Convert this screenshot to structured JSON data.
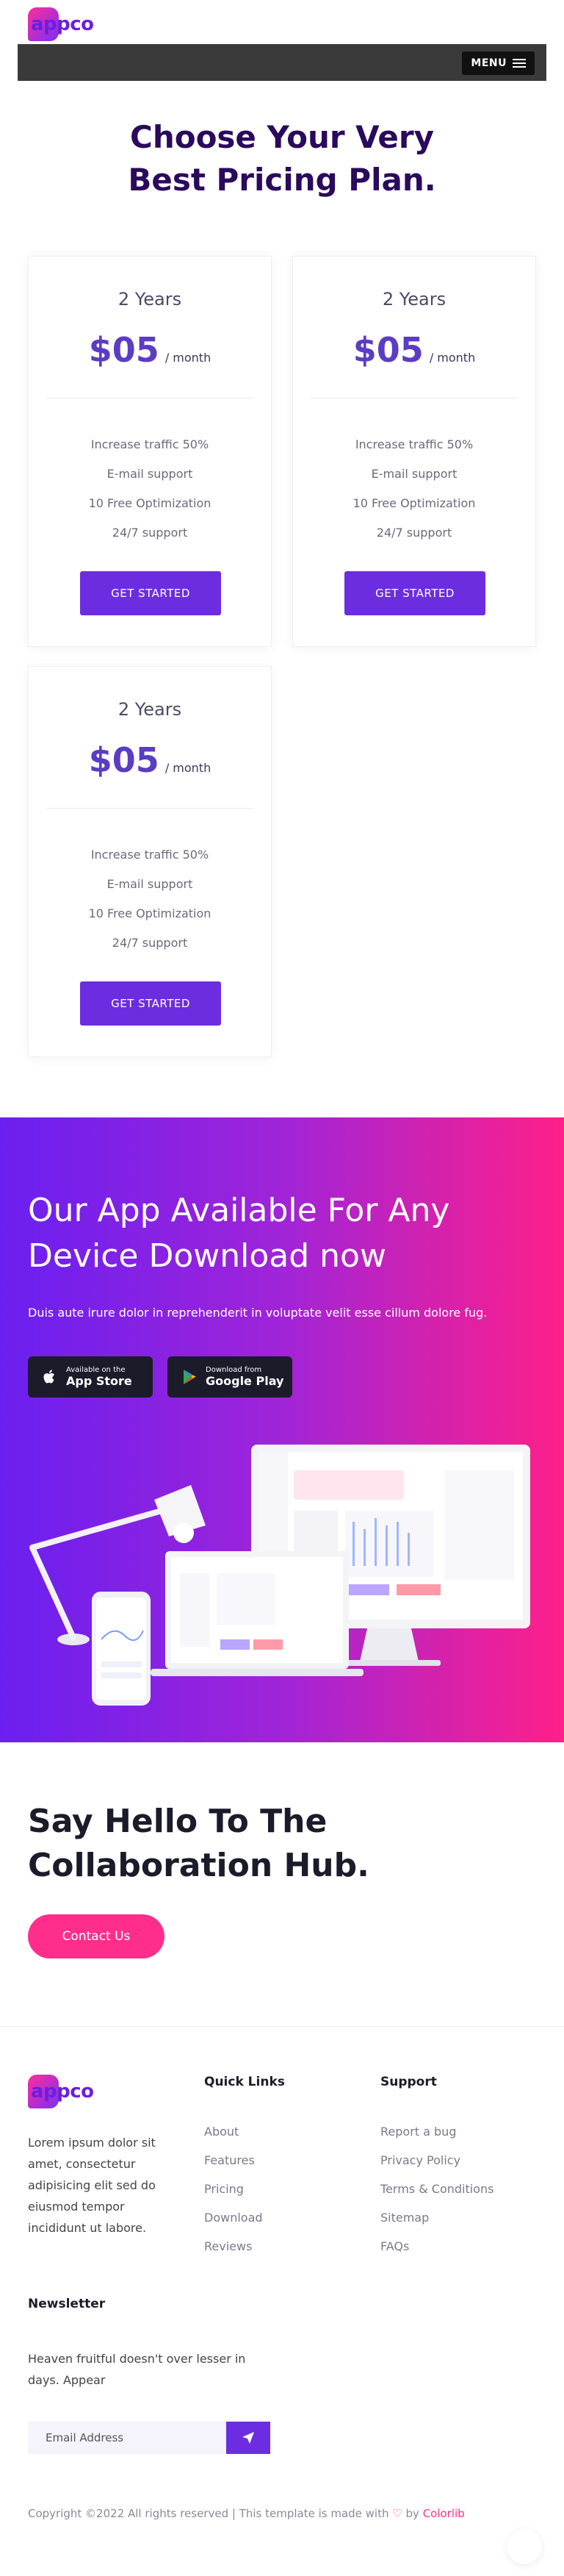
{
  "brand": {
    "logo": "appco"
  },
  "header": {
    "menu_label": "MENU"
  },
  "pricing": {
    "title_line1": "Choose Your Very",
    "title_line2": "Best Pricing Plan.",
    "plans": [
      {
        "duration": "2 Years",
        "price": "$05",
        "period": "/ month",
        "features": [
          "Increase traffic 50%",
          "E-mail support",
          "10 Free Optimization",
          "24/7 support"
        ],
        "button": "GET STARTED"
      },
      {
        "duration": "2 Years",
        "price": "$05",
        "period": "/ month",
        "features": [
          "Increase traffic 50%",
          "E-mail support",
          "10 Free Optimization",
          "24/7 support"
        ],
        "button": "GET STARTED"
      },
      {
        "duration": "2 Years",
        "price": "$05",
        "period": "/ month",
        "features": [
          "Increase traffic 50%",
          "E-mail support",
          "10 Free Optimization",
          "24/7 support"
        ],
        "button": "GET STARTED"
      }
    ]
  },
  "app_section": {
    "title_line1": "Our App Available For Any",
    "title_line2": "Device Download now",
    "description": "Duis aute irure dolor in reprehenderit in voluptate velit esse cillum dolore fug.",
    "appstore": {
      "small": "Available on the",
      "big": "App Store"
    },
    "googleplay": {
      "small": "Download from",
      "big": "Google Play"
    }
  },
  "collab": {
    "title_line1": "Say Hello To The",
    "title_line2": "Collaboration Hub.",
    "button": "Contact Us"
  },
  "footer": {
    "description": "Lorem ipsum dolor sit amet, consectetur adipisicing elit sed do eiusmod tempor incididunt ut labore.",
    "quick_links": {
      "title": "Quick Links",
      "items": [
        "About",
        "Features",
        "Pricing",
        "Download",
        "Reviews"
      ]
    },
    "support": {
      "title": "Support",
      "items": [
        "Report a bug",
        "Privacy Policy",
        "Terms & Conditions",
        "Sitemap",
        "FAQs"
      ]
    },
    "newsletter": {
      "title": "Newsletter",
      "description": "Heaven fruitful doesn't over lesser in days. Appear",
      "placeholder": "Email Address"
    },
    "copyright_pre": "Copyright ©2022 All rights reserved | This template is made with",
    "copyright_by": "by",
    "copyright_brand": "Colorlib"
  },
  "colors": {
    "accent": "#6c2de0",
    "pink": "#ff2e8c",
    "title": "#2a0a5c"
  }
}
